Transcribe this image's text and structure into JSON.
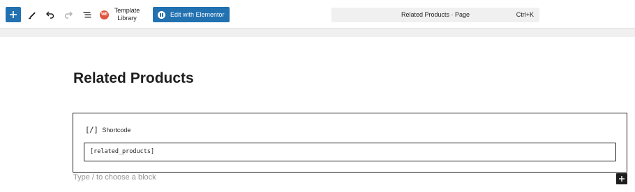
{
  "toolbar": {
    "add_icon": "plus-icon",
    "tools_icon": "pencil-icon",
    "undo_icon": "undo-icon",
    "redo_icon": "redo-icon",
    "outline_icon": "list-view-icon",
    "template_library": {
      "logo_text": "WE",
      "label": "Template Library"
    },
    "elementor_button": {
      "label": "Edit with Elementor",
      "icon": "elementor-icon"
    },
    "command_bar": {
      "title": "Related Products · Page",
      "shortcut": "Ctrl+K"
    }
  },
  "content": {
    "page_title": "Related Products",
    "shortcode_block": {
      "icon": "[/]",
      "label": "Shortcode",
      "value": "[related_products]"
    },
    "block_placeholder": "Type / to choose a block",
    "inserter_icon": "plus-icon"
  },
  "colors": {
    "accent": "#2271b1",
    "text": "#1e1e1e",
    "muted": "#949494",
    "logo": "#e0533c"
  }
}
